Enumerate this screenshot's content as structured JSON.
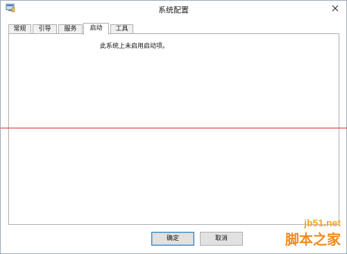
{
  "window": {
    "title": "系统配置",
    "icon": "msconfig-icon"
  },
  "tabs": [
    {
      "label": "常规",
      "active": false
    },
    {
      "label": "引导",
      "active": false
    },
    {
      "label": "服务",
      "active": false
    },
    {
      "label": "启动",
      "active": true
    },
    {
      "label": "工具",
      "active": false
    }
  ],
  "panel": {
    "message": "此系统上未启用启动项。"
  },
  "buttons": {
    "ok": "确定",
    "cancel": "取消"
  },
  "watermark": {
    "site": "jb51.net",
    "name": "脚本之家"
  },
  "colors": {
    "accent_line": "#d32a2a",
    "default_button_border": "#3c7fb1"
  }
}
